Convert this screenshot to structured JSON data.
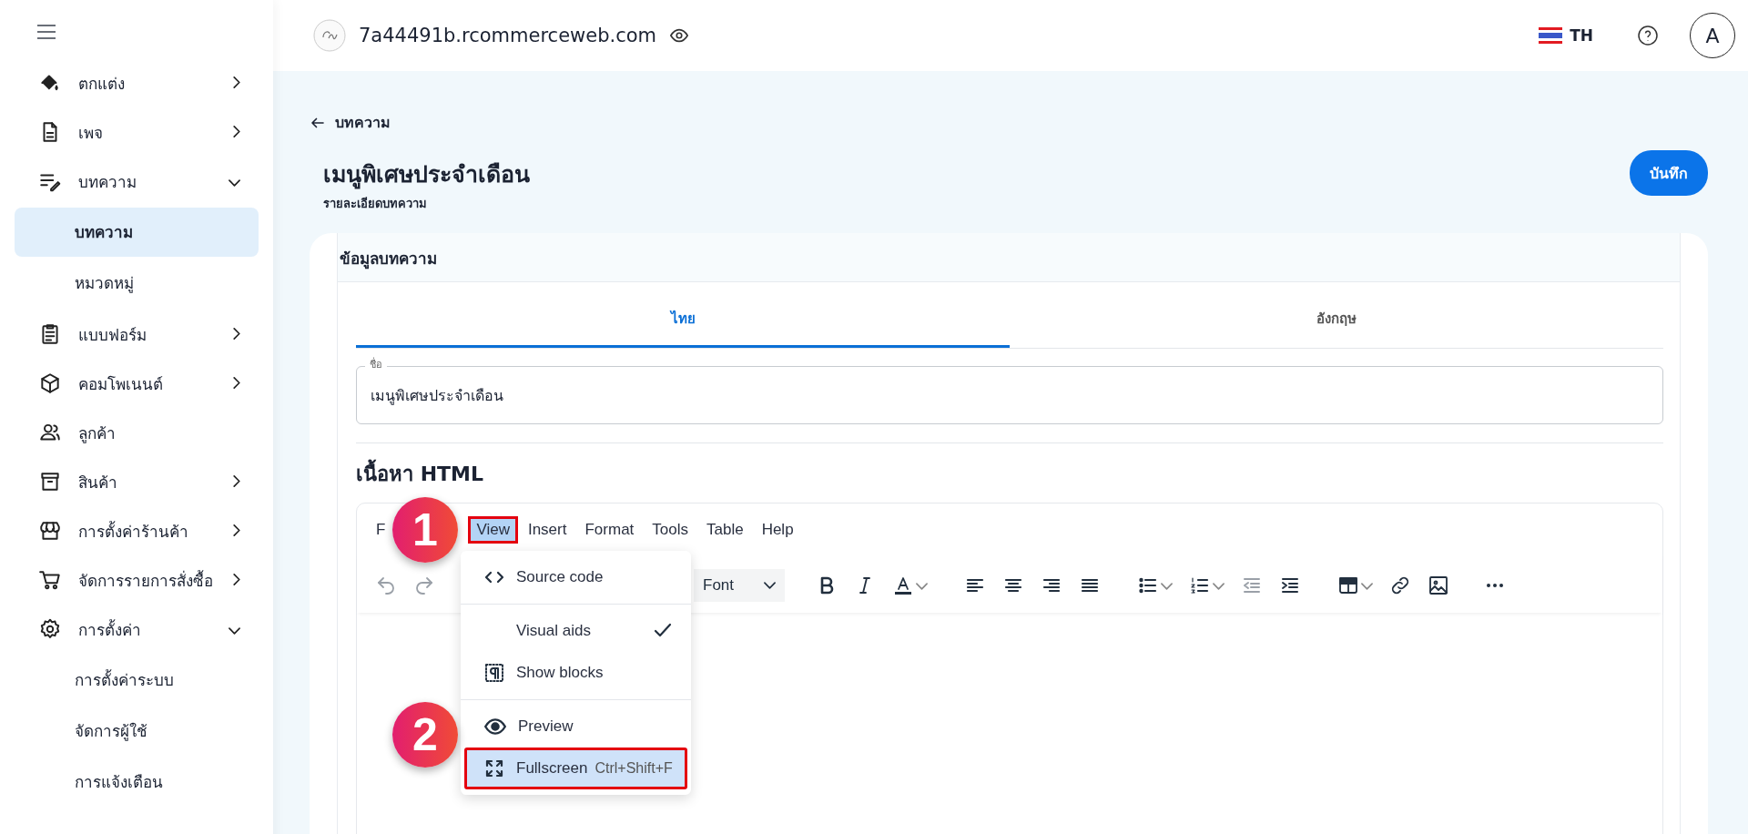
{
  "sidebar": {
    "items": [
      {
        "label": "ตกแต่ง",
        "kind": "group",
        "expanded": false
      },
      {
        "label": "เพจ",
        "kind": "group",
        "expanded": false
      },
      {
        "label": "บทความ",
        "kind": "group",
        "expanded": true,
        "children": [
          {
            "label": "บทความ",
            "selected": true
          },
          {
            "label": "หมวดหมู่",
            "selected": false
          }
        ]
      },
      {
        "label": "แบบฟอร์ม",
        "kind": "group",
        "expanded": false
      },
      {
        "label": "คอมโพเนนต์",
        "kind": "group",
        "expanded": false
      },
      {
        "label": "ลูกค้า",
        "kind": "link"
      },
      {
        "label": "สินค้า",
        "kind": "group",
        "expanded": false
      },
      {
        "label": "การตั้งค่าร้านค้า",
        "kind": "group",
        "expanded": false
      },
      {
        "label": "จัดการรายการสั่งซื้อ",
        "kind": "group",
        "expanded": false
      },
      {
        "label": "การตั้งค่า",
        "kind": "group",
        "expanded": true,
        "children": [
          {
            "label": "การตั้งค่าระบบ",
            "selected": false
          },
          {
            "label": "จัดการผู้ใช้",
            "selected": false
          },
          {
            "label": "การแจ้งเตือน",
            "selected": false
          }
        ]
      }
    ]
  },
  "header": {
    "domain": "7a44491b.rcommerceweb.com",
    "language": "TH",
    "avatar": "A"
  },
  "page": {
    "back_label": "บทความ",
    "title": "เมนูพิเศษประจำเดือน",
    "subtitle": "รายละเอียดบทความ",
    "save_button": "บันทึก"
  },
  "card": {
    "title": "ข้อมูลบทความ",
    "tabs": [
      {
        "label": "ไทย",
        "selected": true
      },
      {
        "label": "อังกฤษ",
        "selected": false
      }
    ],
    "name_field": {
      "label": "ชื่อ",
      "value": "เมนูพิเศษประจำเดือน"
    },
    "content_heading": "เนื้อหา HTML"
  },
  "editor": {
    "menubar": [
      {
        "label": "F",
        "selected": false,
        "outlined": false
      },
      {
        "label": "View",
        "selected": true,
        "outlined": true
      },
      {
        "label": "Insert",
        "selected": false,
        "outlined": false
      },
      {
        "label": "Format",
        "selected": false,
        "outlined": false
      },
      {
        "label": "Tools",
        "selected": false,
        "outlined": false
      },
      {
        "label": "Table",
        "selected": false,
        "outlined": false
      },
      {
        "label": "Help",
        "selected": false,
        "outlined": false
      }
    ],
    "toolbar_groups": [
      [
        {
          "kind": "undo",
          "disabled": true
        },
        {
          "kind": "redo",
          "disabled": true
        }
      ],
      [
        {
          "kind": "font",
          "label": "Font",
          "disabled": false
        }
      ],
      [
        {
          "kind": "bold",
          "disabled": false
        },
        {
          "kind": "italic",
          "disabled": false
        },
        {
          "kind": "text-color",
          "disabled": false
        }
      ],
      [
        {
          "kind": "align-left",
          "disabled": false
        },
        {
          "kind": "align-center",
          "disabled": false
        },
        {
          "kind": "align-right",
          "disabled": false
        },
        {
          "kind": "justify",
          "disabled": false
        }
      ],
      [
        {
          "kind": "bullet-list",
          "disabled": false
        },
        {
          "kind": "numbered-list",
          "disabled": false
        },
        {
          "kind": "outdent",
          "disabled": true
        },
        {
          "kind": "indent",
          "disabled": false
        }
      ],
      [
        {
          "kind": "table",
          "disabled": false
        },
        {
          "kind": "link",
          "disabled": false
        },
        {
          "kind": "image",
          "disabled": false
        }
      ],
      [
        {
          "kind": "more",
          "disabled": false
        }
      ]
    ],
    "view_menu": [
      {
        "kind": "item",
        "label": "Source code",
        "checked": false,
        "selected": false,
        "outlined": false
      },
      {
        "kind": "divider"
      },
      {
        "kind": "item",
        "label": "Visual aids",
        "checked": true,
        "selected": false,
        "outlined": false
      },
      {
        "kind": "item",
        "label": "Show blocks",
        "checked": false,
        "selected": false,
        "outlined": false
      },
      {
        "kind": "divider"
      },
      {
        "kind": "item",
        "label": "Preview",
        "checked": false,
        "selected": false,
        "outlined": false
      },
      {
        "kind": "item",
        "label": "Fullscreen",
        "shortcut": "Ctrl+Shift+F",
        "checked": false,
        "selected": true,
        "outlined": true
      }
    ],
    "callouts": [
      {
        "label": "1"
      },
      {
        "label": "2"
      }
    ]
  }
}
